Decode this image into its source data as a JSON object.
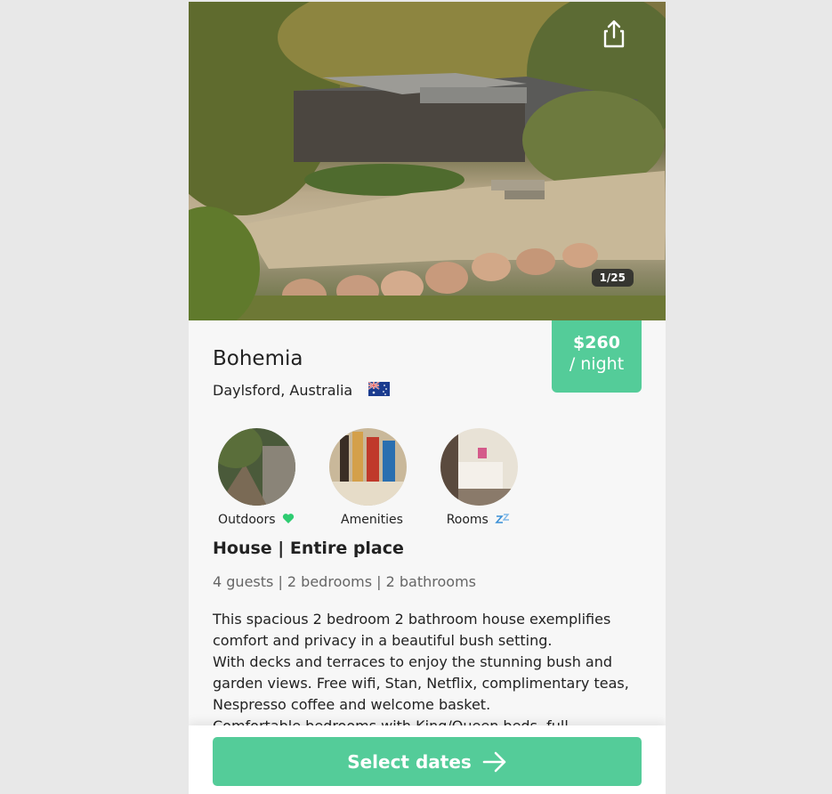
{
  "listing": {
    "title": "Bohemia",
    "location": "Daylsford, Australia",
    "flag_icon": "australia-flag-icon",
    "price": "$260",
    "price_unit": "/ night",
    "photo_counter": "1/25",
    "type": "House | Entire place",
    "stats": "4 guests | 2 bedrooms | 2 bathrooms",
    "description": [
      "This spacious 2 bedroom 2 bathroom house exemplifies comfort and privacy in a beautiful bush setting.",
      "With decks and terraces to enjoy the stunning bush and garden views. Free wifi, Stan, Netflix, complimentary teas, Nespresso coffee and welcome basket.",
      "Comfortable bedrooms with King/Queen beds, full"
    ]
  },
  "categories": [
    {
      "label": "Outdoors",
      "icon": "green-heart-icon"
    },
    {
      "label": "Amenities",
      "icon": ""
    },
    {
      "label": "Rooms",
      "icon": "zzz-icon"
    }
  ],
  "footer": {
    "cta_label": "Select dates",
    "cta_icon": "arrow-right-icon"
  },
  "colors": {
    "accent": "#54cc99",
    "background": "#f7f7f7",
    "page": "#e8e8e8"
  }
}
